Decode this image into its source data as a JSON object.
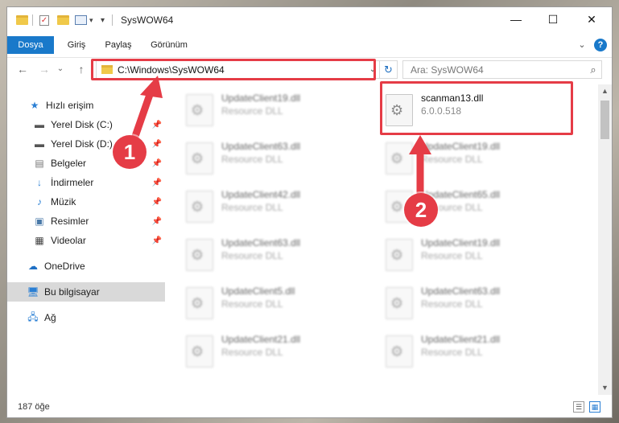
{
  "window": {
    "title": "SysWOW64",
    "controls": {
      "minimize": "—",
      "maximize": "☐",
      "close": "✕"
    }
  },
  "ribbon": {
    "tabs": [
      "Dosya",
      "Giriş",
      "Paylaş",
      "Görünüm"
    ],
    "collapse": "⌄",
    "help": "?"
  },
  "nav": {
    "back": "←",
    "forward": "→",
    "recent": "⌄",
    "up": "↑",
    "address": "C:\\Windows\\SysWOW64",
    "address_dropdown": "⌄",
    "refresh": "↻",
    "search_placeholder": "Ara: SysWOW64",
    "search_icon": "⌕"
  },
  "sidebar": {
    "items": [
      {
        "label": "Hızlı erişim",
        "icon": "star-icon"
      },
      {
        "label": "Yerel Disk (C:)",
        "icon": "drive-icon",
        "pinned": true
      },
      {
        "label": "Yerel Disk (D:)",
        "icon": "drive-icon",
        "pinned": true
      },
      {
        "label": "Belgeler",
        "icon": "documents-icon",
        "pinned": true
      },
      {
        "label": "İndirmeler",
        "icon": "downloads-icon",
        "pinned": true
      },
      {
        "label": "Müzik",
        "icon": "music-icon",
        "pinned": true
      },
      {
        "label": "Resimler",
        "icon": "pictures-icon",
        "pinned": true
      },
      {
        "label": "Videolar",
        "icon": "videos-icon",
        "pinned": true
      },
      {
        "label": "OneDrive",
        "icon": "cloud-icon"
      },
      {
        "label": "Bu bilgisayar",
        "icon": "computer-icon",
        "selected": true
      },
      {
        "label": "Ağ",
        "icon": "network-icon"
      }
    ]
  },
  "files": {
    "left": [
      {
        "name": "UpdateClient19.dll",
        "type": "Resource DLL"
      },
      {
        "name": "UpdateClient63.dll",
        "type": "Resource DLL"
      },
      {
        "name": "UpdateClient42.dll",
        "type": "Resource DLL"
      },
      {
        "name": "UpdateClient63.dll",
        "type": "Resource DLL"
      },
      {
        "name": "UpdateClient5.dll",
        "type": "Resource DLL"
      },
      {
        "name": "UpdateClient21.dll",
        "type": "Resource DLL"
      }
    ],
    "right": [
      {
        "name": "scanman13.dll",
        "type": "6.0.0.518"
      },
      {
        "name": "UpdateClient19.dll",
        "type": "Resource DLL"
      },
      {
        "name": "UpdateClient65.dll",
        "type": "Resource DLL"
      },
      {
        "name": "UpdateClient19.dll",
        "type": "Resource DLL"
      },
      {
        "name": "UpdateClient63.dll",
        "type": "Resource DLL"
      },
      {
        "name": "UpdateClient21.dll",
        "type": "Resource DLL"
      }
    ]
  },
  "status": {
    "count": "187 öğe"
  },
  "annotations": {
    "step1": "1",
    "step2": "2",
    "color": "#e53c46"
  }
}
